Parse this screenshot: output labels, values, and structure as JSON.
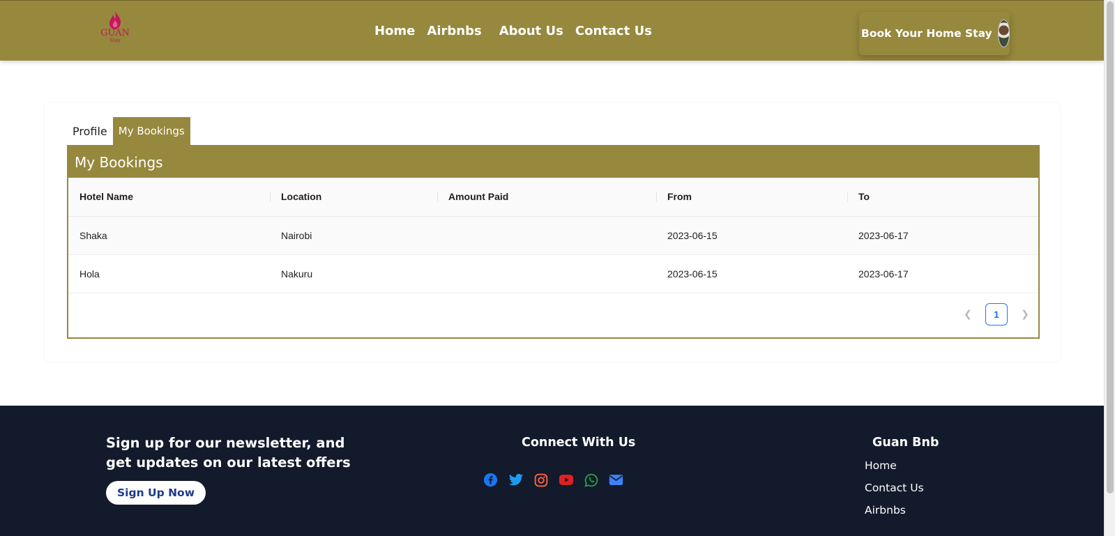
{
  "header": {
    "logo_text": "GUAN",
    "logo_sub": "Stay",
    "nav": [
      "Home",
      "Airbnbs",
      "About Us",
      "Contact Us"
    ],
    "cta_label": "Book Your Home Stay"
  },
  "tabs": [
    {
      "label": "Profile",
      "active": false
    },
    {
      "label": "My Bookings",
      "active": true
    }
  ],
  "bookings": {
    "title": "My Bookings",
    "columns": [
      "Hotel Name",
      "Location",
      "Amount Paid",
      "From",
      "To"
    ],
    "rows": [
      {
        "hotel": "Shaka",
        "location": "Nairobi",
        "amount": "",
        "from": "2023-06-15",
        "to": "2023-06-17"
      },
      {
        "hotel": "Hola",
        "location": "Nakuru",
        "amount": "",
        "from": "2023-06-15",
        "to": "2023-06-17"
      }
    ],
    "pagination": {
      "prev_icon": "chevron-left-icon",
      "current": "1",
      "next_icon": "chevron-right-icon"
    }
  },
  "footer": {
    "newsletter_text": "Sign up for our newsletter, and get updates on our latest offers",
    "signup_label": "Sign Up Now",
    "connect_title": "Connect With Us",
    "socials": [
      {
        "icon": "facebook-icon",
        "color": "#1877f2"
      },
      {
        "icon": "twitter-icon",
        "color": "#1d9bf0"
      },
      {
        "icon": "instagram-icon",
        "color": "#f56040"
      },
      {
        "icon": "youtube-icon",
        "color": "#e02020"
      },
      {
        "icon": "whatsapp-icon",
        "color": "#25a244"
      },
      {
        "icon": "email-icon",
        "color": "#3b82f6"
      }
    ],
    "brand_title": "Guan Bnb",
    "links": [
      "Home",
      "Contact Us",
      "Airbnbs"
    ]
  },
  "colors": {
    "accent": "#96883d",
    "footer_bg": "#131a2b",
    "pager_active": "#1677ff"
  }
}
